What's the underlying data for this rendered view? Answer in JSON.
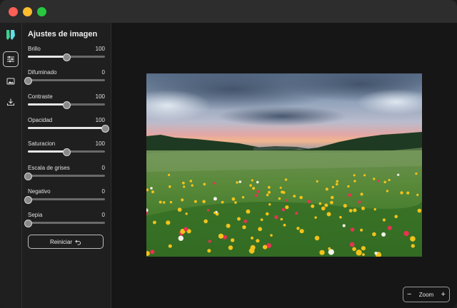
{
  "panel": {
    "title": "Ajustes de imagen",
    "reset_label": "Reiniciar"
  },
  "controls": [
    {
      "label": "Brillo",
      "value": "100",
      "level": 0.5
    },
    {
      "label": "Difuminado",
      "value": "0",
      "level": 0.0
    },
    {
      "label": "Contraste",
      "value": "100",
      "level": 0.5
    },
    {
      "label": "Opacidad",
      "value": "100",
      "level": 1.0
    },
    {
      "label": "Saturacion",
      "value": "100",
      "level": 0.5
    },
    {
      "label": "Escala de grises",
      "value": "0",
      "level": 0.0
    },
    {
      "label": "Negativo",
      "value": "0",
      "level": 0.0
    },
    {
      "label": "Sepia",
      "value": "0",
      "level": 0.0
    }
  ],
  "zoom": {
    "label": "Zoom",
    "minus": "−",
    "plus": "+"
  },
  "rail": {
    "items": [
      {
        "icon": "adjustments-icon",
        "active": true
      },
      {
        "icon": "image-icon",
        "active": false
      },
      {
        "icon": "download-icon",
        "active": false
      }
    ]
  },
  "colors": {
    "logo_primary": "#3ecf8e",
    "logo_secondary": "#5de0e6"
  }
}
